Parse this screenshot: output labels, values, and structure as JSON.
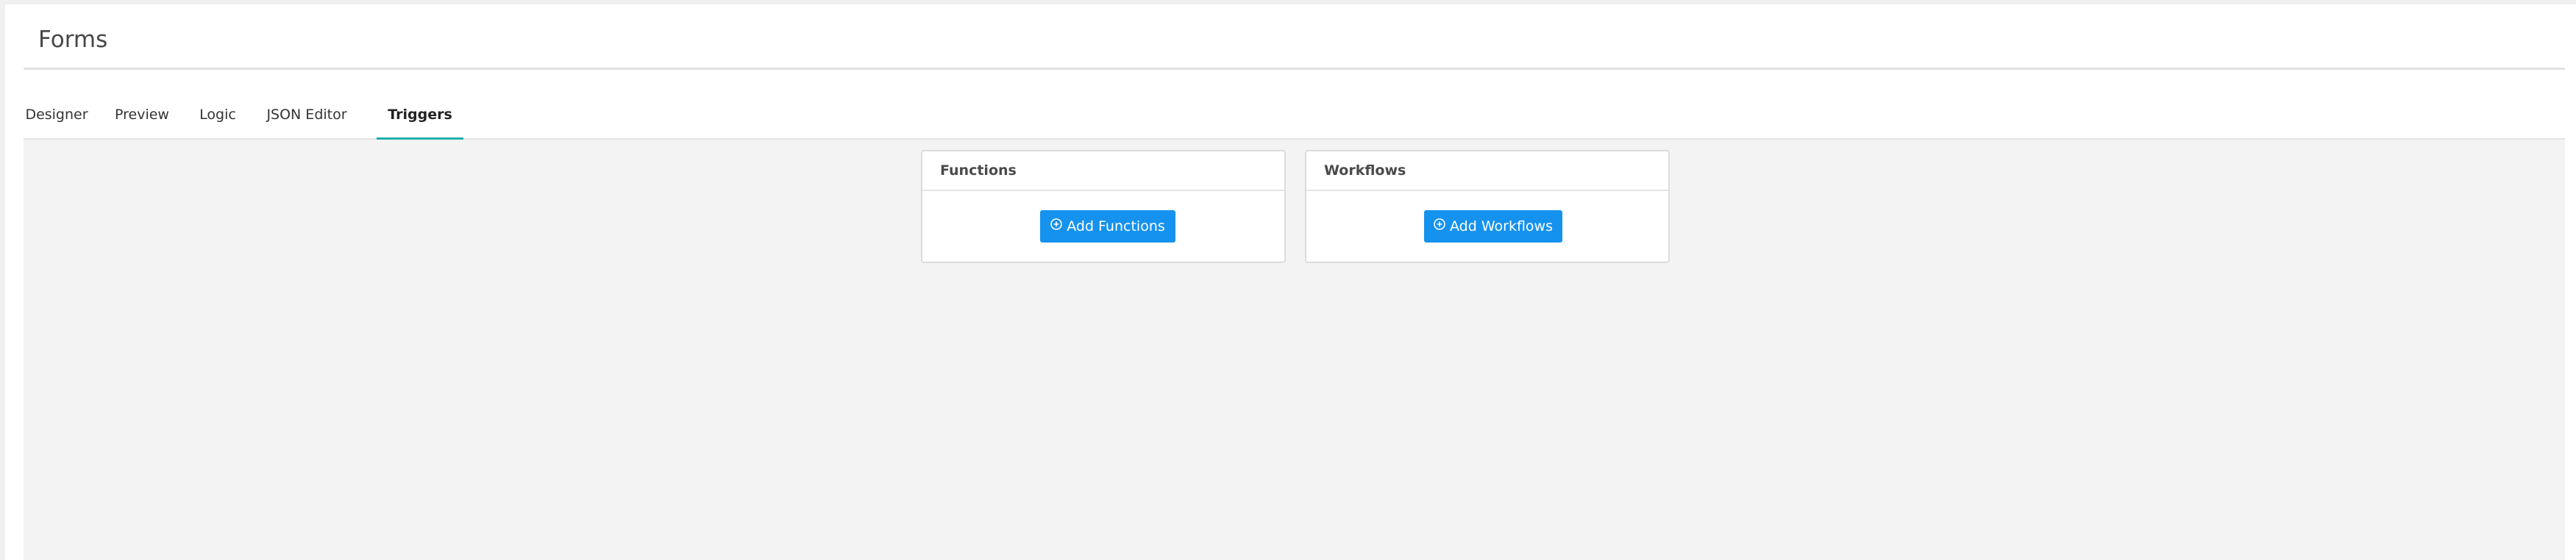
{
  "page": {
    "title": "Forms"
  },
  "tabs": [
    {
      "label": "Designer"
    },
    {
      "label": "Preview"
    },
    {
      "label": "Logic"
    },
    {
      "label": "JSON Editor"
    },
    {
      "label": "Triggers",
      "active": true
    }
  ],
  "cards": {
    "functions": {
      "title": "Functions",
      "button_label": "Add Functions",
      "button_icon": "plus-circle-icon"
    },
    "workflows": {
      "title": "Workflows",
      "button_label": "Add Workflows",
      "button_icon": "plus-circle-icon"
    }
  },
  "colors": {
    "accent_tab": "#1ab1a7",
    "button_primary": "#1592ee"
  }
}
